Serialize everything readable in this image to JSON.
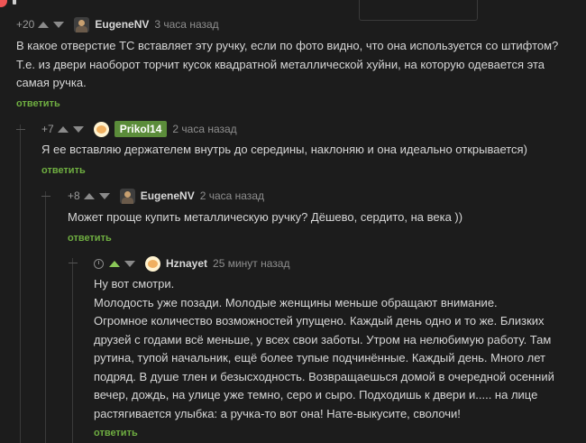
{
  "comments": [
    {
      "rating": "+20",
      "username": "EugeneNV",
      "time": "3 часа назад",
      "lines": [
        "В какое отверстие ТС вставляет эту ручку, если по фото видно, что она используется со штифтом?",
        "Т.е. из двери наоборот торчит кусок квадратной металлической хуйни, на которую одевается эта",
        "самая ручка."
      ],
      "reply": "ответить"
    },
    {
      "rating": "+7",
      "username": "Prikol14",
      "time": "2 часа назад",
      "lines": [
        "Я ее вставляю держателем внутрь до середины, наклоняю и она идеально открывается)"
      ],
      "reply": "ответить"
    },
    {
      "rating": "+8",
      "username": "EugeneNV",
      "time": "2 часа назад",
      "lines": [
        "Может проще купить металлическую ручку? Дёшево, сердито, на века ))"
      ],
      "reply": "ответить"
    },
    {
      "rating": "",
      "username": "Hznayet",
      "time": "25 минут назад",
      "lines": [
        "Ну вот смотри.",
        "Молодость уже позади. Молодые женщины меньше обращают внимание.",
        "Огромное количество возможностей упущено. Каждый день одно и то же. Близких",
        "друзей с годами всё меньше, у всех свои заботы. Утром на нелюбимую работу. Там",
        "рутина, тупой начальник, ещё более тупые подчинённые. Каждый день. Много лет",
        "подряд. В душе тлен и безысходность. Возвращаешься домой в очередной осенний",
        "вечер, дождь, на улице уже темно, серо и сыро. Подходишь к двери и..... на лице",
        "растягивается улыбка: а ручка-то вот она! Нате-выкусите, сволочи!"
      ],
      "reply": "ответить"
    }
  ]
}
